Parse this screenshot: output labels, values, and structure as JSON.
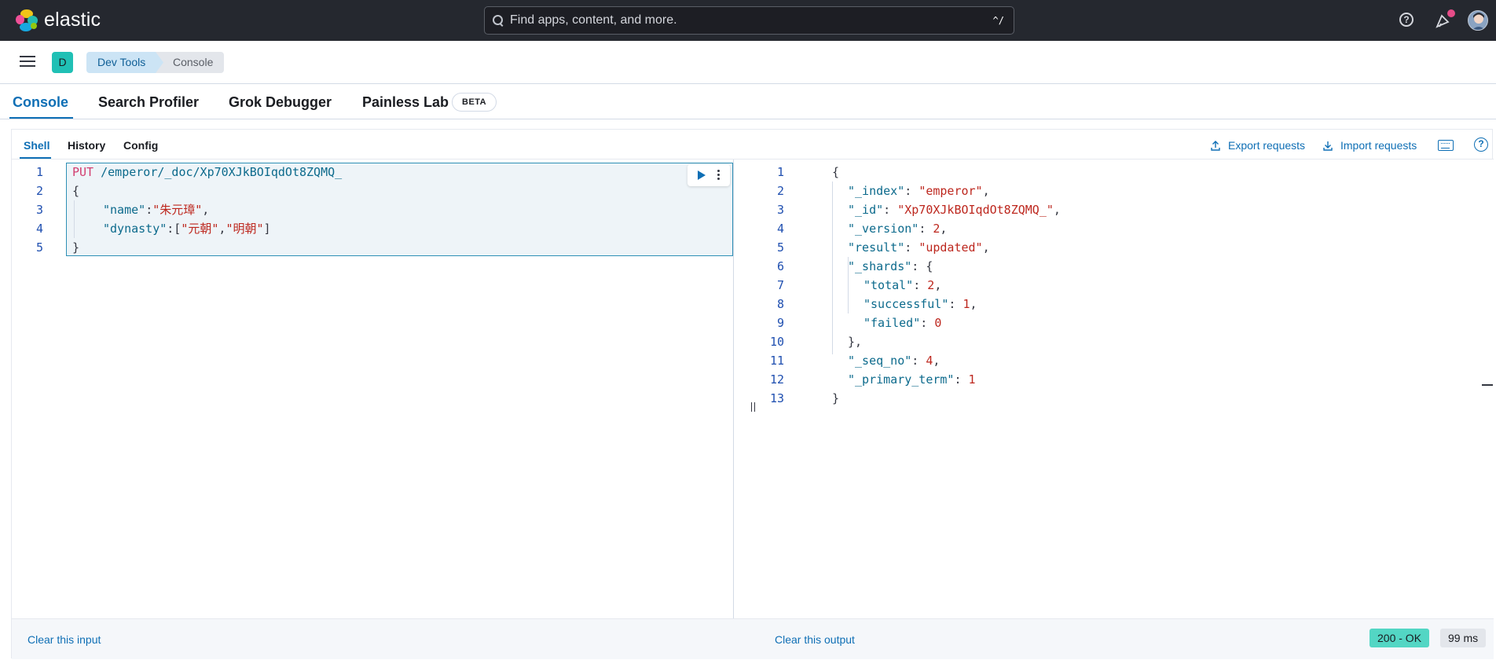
{
  "header": {
    "app_name": "elastic",
    "search_placeholder": "Find apps, content, and more.",
    "search_shortcut": "^/",
    "help_icon": "help-icon",
    "notification_icon": "newsfeed-icon",
    "accent": "#25282f"
  },
  "breadcrumb": {
    "space_initial": "D",
    "items": [
      "Dev Tools",
      "Console"
    ]
  },
  "tabs": {
    "items": [
      "Console",
      "Search Profiler",
      "Grok Debugger",
      "Painless Lab"
    ],
    "active": "Console",
    "beta_label": "BETA"
  },
  "console": {
    "subtabs": [
      "Shell",
      "History",
      "Config"
    ],
    "active_subtab": "Shell",
    "export_label": "Export requests",
    "import_label": "Import requests",
    "request": {
      "line_numbers": [
        "1",
        "2",
        "3",
        "4",
        "5"
      ],
      "method": "PUT",
      "path": "/emperor/_doc/Xp70XJkBOIqdOt8ZQMQ_",
      "name_key": "\"name\"",
      "name_value": "\"朱元璋\"",
      "dynasty_key": "\"dynasty\"",
      "dynasty_values": [
        "\"元朝\"",
        "\"明朝\""
      ]
    },
    "response": {
      "line_numbers": [
        "1",
        "2",
        "3",
        "4",
        "5",
        "6",
        "7",
        "8",
        "9",
        "10",
        "11",
        "12",
        "13"
      ],
      "index_key": "\"_index\"",
      "index_value": "\"emperor\"",
      "id_key": "\"_id\"",
      "id_value": "\"Xp70XJkBOIqdOt8ZQMQ_\"",
      "version_key": "\"_version\"",
      "version_value": "2",
      "result_key": "\"result\"",
      "result_value": "\"updated\"",
      "shards_key": "\"_shards\"",
      "total_key": "\"total\"",
      "total_value": "2",
      "successful_key": "\"successful\"",
      "successful_value": "1",
      "failed_key": "\"failed\"",
      "failed_value": "0",
      "seq_no_key": "\"_seq_no\"",
      "seq_no_value": "4",
      "primary_term_key": "\"_primary_term\"",
      "primary_term_value": "1"
    },
    "footer": {
      "clear_input": "Clear this input",
      "clear_output": "Clear this output",
      "status": "200 - OK",
      "time": "99 ms",
      "status_color": "#53d6c4"
    }
  }
}
